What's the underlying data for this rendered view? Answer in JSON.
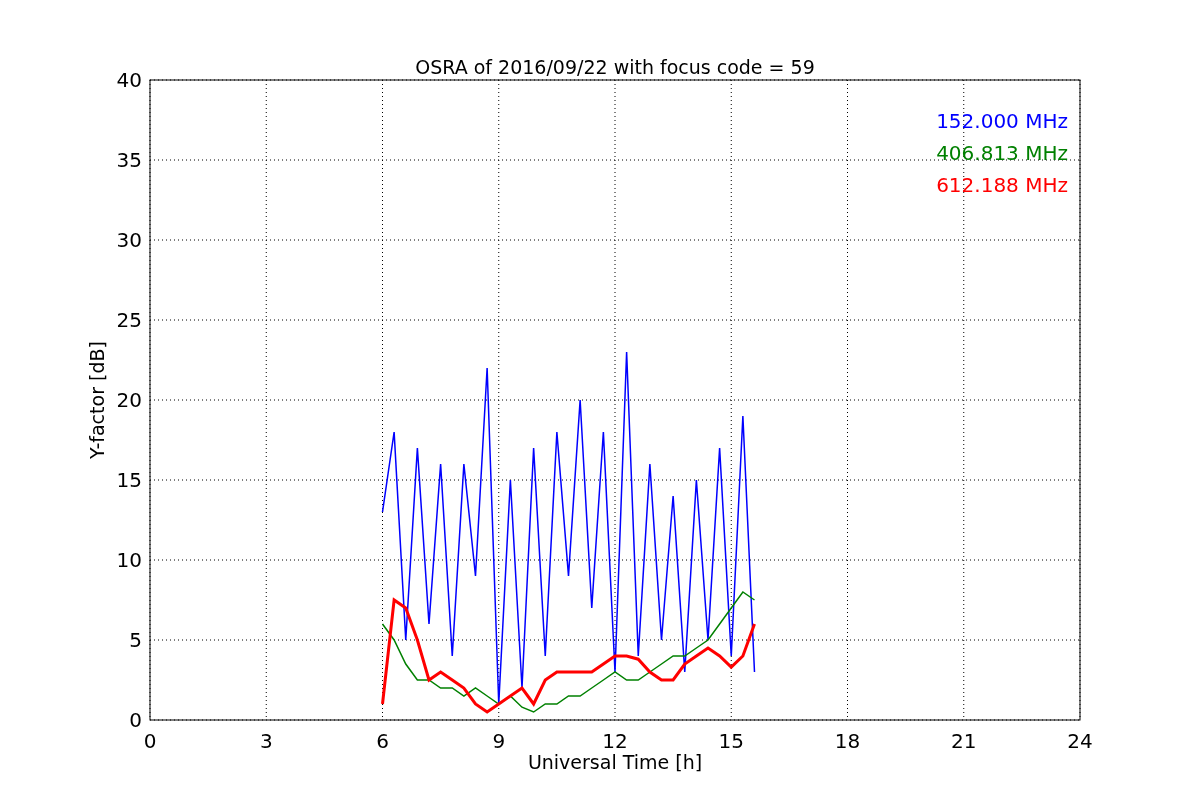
{
  "chart_data": {
    "type": "line",
    "title": "OSRA of 2016/09/22 with focus code = 59",
    "xlabel": "Universal Time [h]",
    "ylabel": "Y-factor [dB]",
    "x": [
      6.0,
      6.3,
      6.6,
      6.9,
      7.2,
      7.5,
      7.8,
      8.1,
      8.4,
      8.7,
      9.0,
      9.3,
      9.6,
      9.9,
      10.2,
      10.5,
      10.8,
      11.1,
      11.4,
      11.7,
      12.0,
      12.3,
      12.6,
      12.9,
      13.2,
      13.5,
      13.8,
      14.1,
      14.4,
      14.7,
      15.0,
      15.3,
      15.6
    ],
    "series": [
      {
        "name": "152.000 MHz",
        "color": "#0000ff",
        "values": [
          13,
          18,
          5,
          17,
          6,
          16,
          4,
          16,
          9,
          22,
          1,
          15,
          2,
          17,
          4,
          18,
          9,
          20,
          7,
          18,
          3,
          23,
          4,
          16,
          5,
          14,
          3,
          15,
          5,
          17,
          4,
          19,
          3
        ]
      },
      {
        "name": "406.813 MHz",
        "color": "#008000",
        "values": [
          6,
          5,
          3.5,
          2.5,
          2.5,
          2,
          2,
          1.5,
          2,
          1.5,
          1,
          1.5,
          0.8,
          0.5,
          1,
          1,
          1.5,
          1.5,
          2,
          2.5,
          3,
          2.5,
          2.5,
          3,
          3.5,
          4,
          4,
          4.5,
          5,
          6,
          7,
          8,
          7.5
        ]
      },
      {
        "name": "612.188 MHz",
        "color": "#ff0000",
        "values": [
          1,
          7.5,
          7,
          5,
          2.5,
          3,
          2.5,
          2,
          1,
          0.5,
          1,
          1.5,
          2,
          1,
          2.5,
          3,
          3,
          3,
          3,
          3.5,
          4,
          4,
          3.8,
          3,
          2.5,
          2.5,
          3.5,
          4,
          4.5,
          4,
          3.3,
          4,
          6
        ]
      }
    ],
    "grid": true,
    "xlim": [
      0,
      24
    ],
    "ylim": [
      0,
      40
    ],
    "xticks": [
      0,
      3,
      6,
      9,
      12,
      15,
      18,
      21,
      24
    ],
    "yticks": [
      0,
      5,
      10,
      15,
      20,
      25,
      30,
      35,
      40
    ]
  }
}
